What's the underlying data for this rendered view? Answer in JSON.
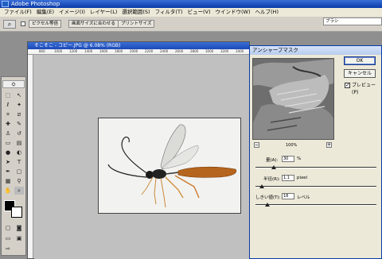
{
  "app": {
    "title": "Adobe Photoshop"
  },
  "menubar": {
    "items": [
      "ファイル(F)",
      "編集(E)",
      "イメージ(I)",
      "レイヤー(L)",
      "選択範囲(S)",
      "フィルタ(T)",
      "ビュー(V)",
      "ウインドウ(W)",
      "ヘルプ(H)"
    ]
  },
  "optionsbar": {
    "buttons": [
      "ピクセル等倍",
      "画面サイズに合わせる",
      "プリントサイズ"
    ],
    "tab_label": "ブラシ"
  },
  "document": {
    "title": "そこそこ - コピー.JPG @ 6.08% (RGB)",
    "ruler_labels": [
      "800",
      "1000",
      "1200",
      "1400",
      "1600",
      "1800",
      "2000",
      "2200",
      "2400",
      "2600",
      "2800",
      "3000",
      "3200",
      "3400"
    ]
  },
  "dialog": {
    "title": "アンシャープマスク",
    "ok_label": "OK",
    "cancel_label": "キャンセル",
    "preview_label": "プレビュー(P)",
    "preview_checked": true,
    "zoom_level": "100%",
    "zoom_minus": "−",
    "zoom_plus": "+",
    "amount": {
      "label": "量(A):",
      "value": "30",
      "unit": "%",
      "slider_fraction": 0.15
    },
    "radius": {
      "label": "半径(R):",
      "value": "1.1",
      "unit": "pixel",
      "slider_fraction": 0.05
    },
    "threshold": {
      "label": "しきい値(T):",
      "value": "18",
      "unit": "レベル",
      "slider_fraction": 0.1
    }
  }
}
